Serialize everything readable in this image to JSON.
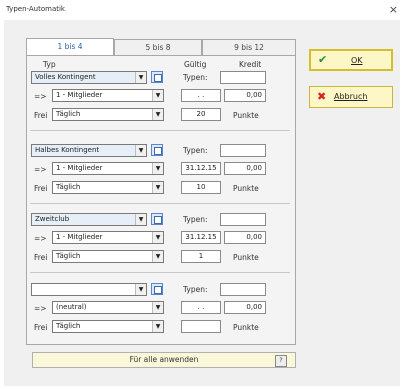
{
  "window": {
    "title": "Typen-Automatik",
    "close_glyph": "×"
  },
  "tabs": [
    {
      "label": "1 bis 4",
      "active": true
    },
    {
      "label": "5 bis 8",
      "active": false
    },
    {
      "label": "9 bis 12",
      "active": false
    }
  ],
  "headers": {
    "typ": "Typ",
    "gueltig": "Gültig",
    "kredit": "Kredit"
  },
  "labels": {
    "arrow": "=>",
    "frei": "Frei",
    "typen": "Typen:",
    "punkte": "Punkte"
  },
  "groups": [
    {
      "type": "Volles Kontingent",
      "member": "1 - Mitglieder",
      "frequency": "Täglich",
      "typen": "",
      "date": ". .",
      "credit": "0,00",
      "points": "20"
    },
    {
      "type": "Halbes Kontingent",
      "member": "1 - Mitglieder",
      "frequency": "Täglich",
      "typen": "",
      "date": "31.12.15",
      "credit": "0,00",
      "points": "10"
    },
    {
      "type": "Zweitclub",
      "member": "1 - Mitglieder",
      "frequency": "Täglich",
      "typen": "",
      "date": "31.12.15",
      "credit": "0,00",
      "points": "1"
    },
    {
      "type": "",
      "member": "(neutral)",
      "frequency": "Täglich",
      "typen": "",
      "date": ". .",
      "credit": "0,00",
      "points": ""
    }
  ],
  "apply_button": {
    "label": "Für alle anwenden"
  },
  "buttons": {
    "ok": "OK",
    "cancel": "Abbruch"
  },
  "icons": {
    "ok": "check-icon",
    "cancel": "x-icon",
    "dropdown": "chevron-down-icon",
    "lookup": "list-icon"
  },
  "colors": {
    "ok_icon": "#2e8b2e",
    "cancel_icon": "#d62020",
    "button_bg": "#fdf6c6",
    "active_tab_text": "#2a5ea8"
  }
}
